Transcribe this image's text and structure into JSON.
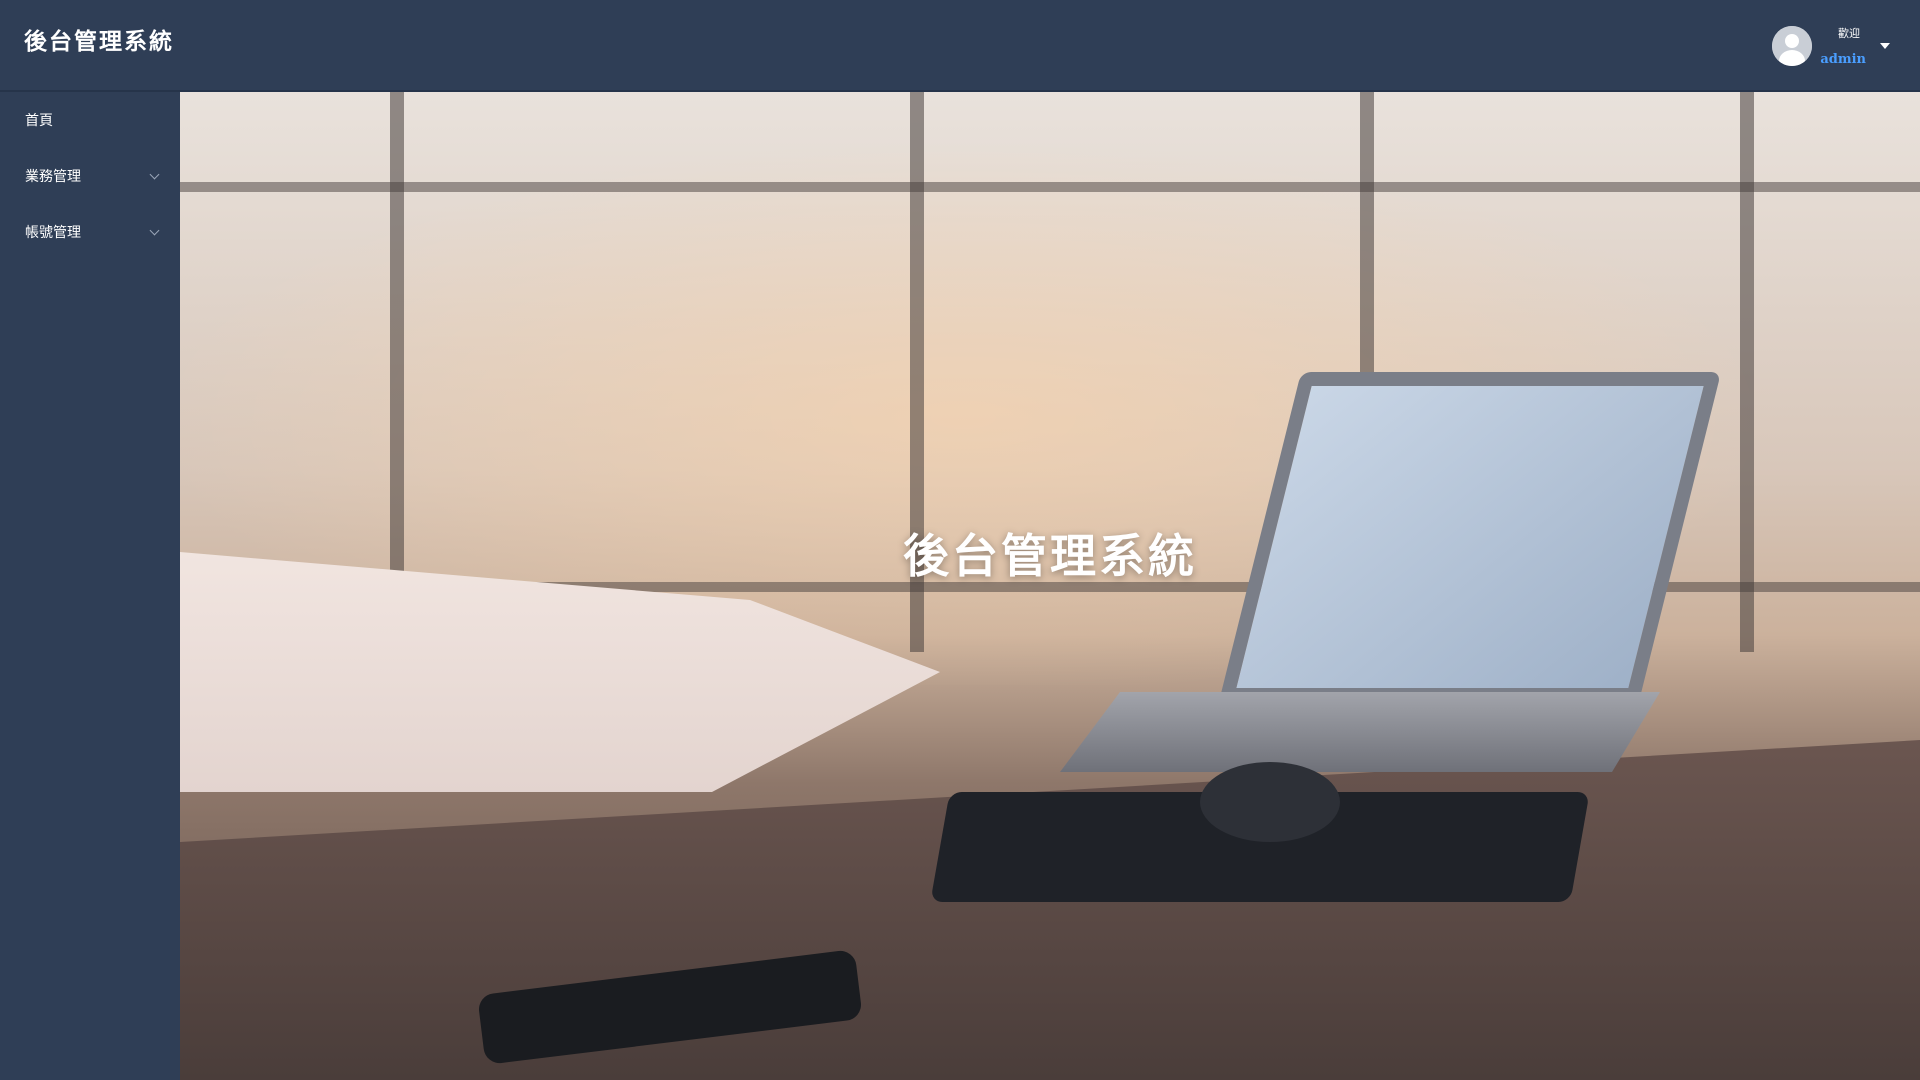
{
  "header": {
    "app_title": "後台管理系統",
    "user": {
      "welcome": "歡迎",
      "username": "admin",
      "avatar_icon": "user-avatar-icon",
      "dropdown_icon": "caret-down-icon"
    }
  },
  "sidebar": {
    "items": [
      {
        "label": "首頁",
        "has_submenu": false
      },
      {
        "label": "業務管理",
        "has_submenu": true,
        "icon": "chevron-down-icon"
      },
      {
        "label": "帳號管理",
        "has_submenu": true,
        "icon": "chevron-down-icon"
      }
    ]
  },
  "main": {
    "banner_title": "後台管理系統"
  },
  "colors": {
    "header_bg": "#2f3e56",
    "sidebar_bg": "#2f3e56",
    "username_accent": "#4a9eff"
  }
}
